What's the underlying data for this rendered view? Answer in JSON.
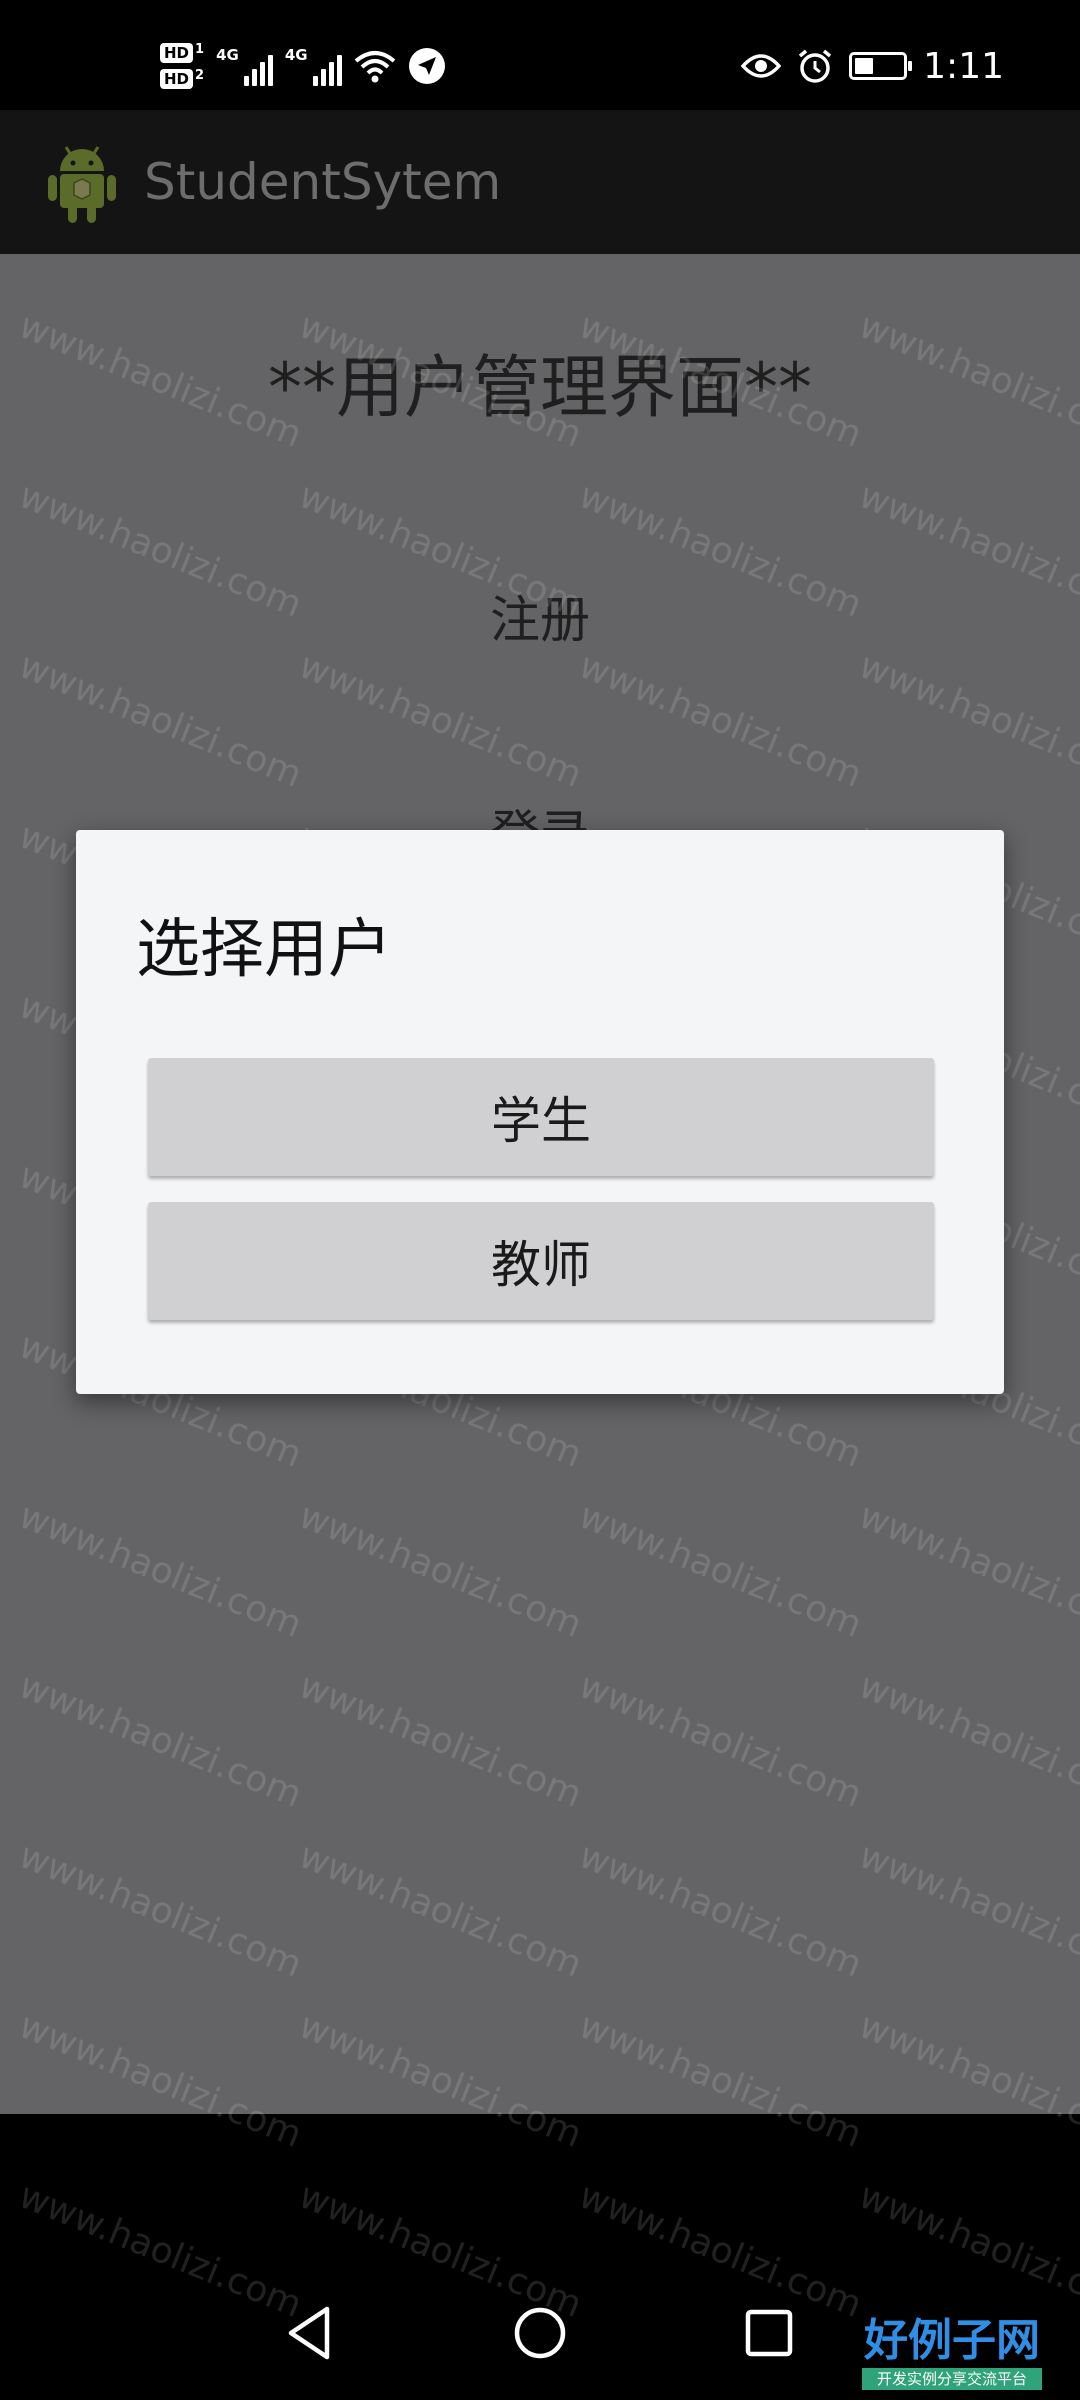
{
  "status_bar": {
    "hd1": "HD",
    "hd1_sub": "1",
    "hd2": "HD",
    "hd2_sub": "2",
    "net1": "4G",
    "net2": "4G",
    "time": "1:11",
    "battery_level": 0.35,
    "icons": [
      "wifi-icon",
      "location-arrow-icon",
      "eye-icon",
      "alarm-icon",
      "battery-icon"
    ]
  },
  "app_bar": {
    "title": "StudentSytem",
    "icon": "android-robot-icon"
  },
  "page": {
    "title": "**用户管理界面**",
    "register": "注册",
    "login": "登录"
  },
  "dialog": {
    "title": "选择用户",
    "options": [
      {
        "label": "学生"
      },
      {
        "label": "教师"
      }
    ]
  },
  "watermark_text": "www.haolizi.com",
  "brand": {
    "main": "好例子网",
    "sub": "开发实例分享交流平台"
  },
  "nav": {
    "icons": [
      "back-icon",
      "home-icon",
      "recents-icon"
    ]
  },
  "colors": {
    "scrim_content": "#646466",
    "dialog_bg": "#f4f5f7",
    "button_bg": "#d0d0d2",
    "brand_blue": "#2f8fe6"
  }
}
